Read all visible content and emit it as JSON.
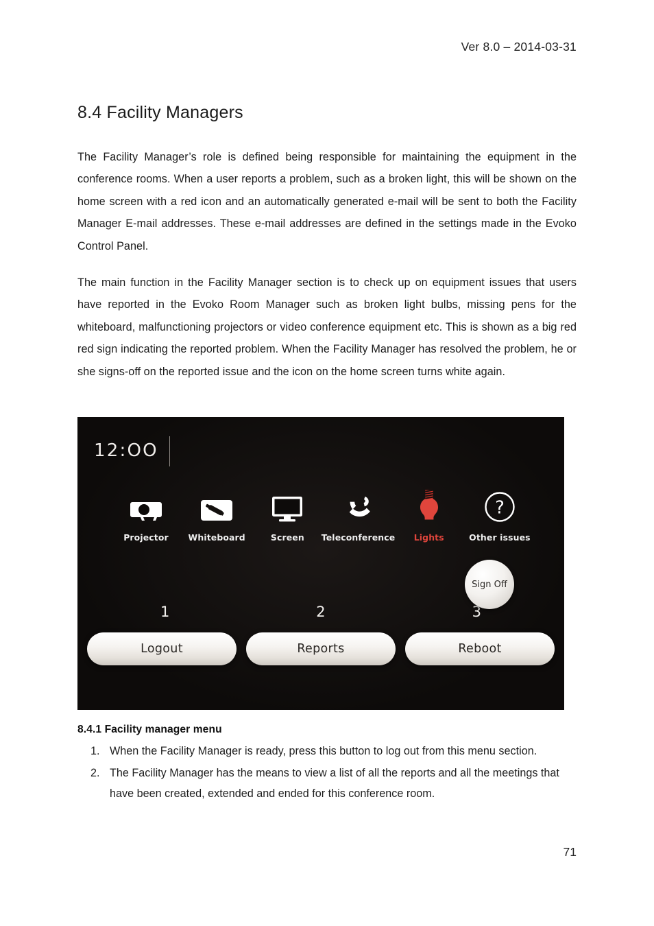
{
  "header": {
    "version_date": "Ver 8.0 – 2014-03-31"
  },
  "section": {
    "number_title": "8.4 Facility Managers",
    "paragraphs": [
      "The Facility Manager’s role is defined being responsible for maintaining the equipment in the conference rooms. When a user reports a problem, such as a broken light, this will be shown on the home screen with a red icon and an automatically generated e-mail will be sent to both the Facility Manager E-mail addresses. These e-mail addresses are defined in the settings made in the Evoko Control Panel.",
      "The main function in the Facility Manager section is to check up on equipment issues that users have reported in the Evoko Room Manager such as broken light bulbs, missing pens for the whiteboard, malfunctioning projectors or video conference equipment etc. This is shown as a big red red sign indicating the reported problem. When the Facility Manager has resolved the problem, he or she signs-off on the reported issue and the icon on the home screen turns white again."
    ]
  },
  "screenshot": {
    "clock": "12:OO",
    "equipment_icons": [
      {
        "icon": "projector-icon",
        "label": "Projector",
        "state": "ok"
      },
      {
        "icon": "whiteboard-icon",
        "label": "Whiteboard",
        "state": "ok"
      },
      {
        "icon": "screen-icon",
        "label": "Screen",
        "state": "ok"
      },
      {
        "icon": "teleconference-phone-icon",
        "label": "Teleconference",
        "state": "ok"
      },
      {
        "icon": "lightbulb-icon",
        "label": "Lights",
        "state": "alert"
      },
      {
        "icon": "question-mark-icon",
        "label": "Other issues",
        "state": "ok"
      }
    ],
    "sign_off_label": "Sign Off",
    "callouts": [
      "1",
      "2",
      "3"
    ],
    "buttons": [
      {
        "label": "Logout"
      },
      {
        "label": "Reports"
      },
      {
        "label": "Reboot"
      }
    ],
    "colors": {
      "background": "#0d0b0a",
      "alert_red": "#e0453c",
      "icon_white": "#ffffff",
      "button_face": "#f3f1ee"
    }
  },
  "subsection": {
    "number_title": "8.4.1 Facility manager menu",
    "items": [
      "When the Facility Manager is ready, press this button to log out from this menu section.",
      "The Facility Manager has the means to view a list of all the reports and all the meetings that have been created, extended and ended for this conference room."
    ]
  },
  "footer": {
    "page_number": "71"
  }
}
